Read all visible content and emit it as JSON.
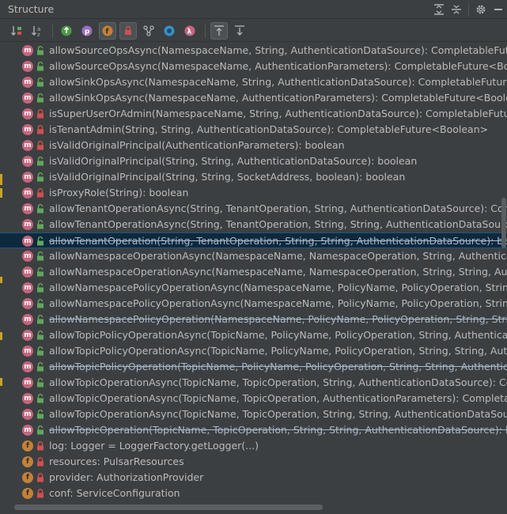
{
  "window": {
    "title": "Structure"
  },
  "toolbar": {
    "items": [
      {
        "name": "sort-by-visibility-icon"
      },
      {
        "name": "sort-alphabetically-icon"
      },
      {
        "name": "show-inherited-icon"
      },
      {
        "name": "show-properties-icon"
      },
      {
        "name": "show-fields-icon"
      },
      {
        "name": "show-non-public-icon"
      },
      {
        "name": "show-lambdas-icon"
      },
      {
        "name": "show-anonymous-icon"
      },
      {
        "name": "show-lambda-icon"
      },
      {
        "name": "autoscroll-to-source-icon"
      },
      {
        "name": "autoscroll-from-source-icon"
      }
    ]
  },
  "colors": {
    "method_badge": "#c5657e",
    "field_badge": "#c2813a",
    "public_lock": "#5fa85b",
    "private_lock": "#d05050",
    "selection": "#0d293e"
  },
  "members": [
    {
      "kind": "m",
      "access": "public",
      "text": "allowSourceOpsAsync(NamespaceName, String, AuthenticationDataSource): CompletableFuture<Boolean>",
      "strike": false
    },
    {
      "kind": "m",
      "access": "public",
      "text": "allowSourceOpsAsync(NamespaceName, AuthenticationParameters): CompletableFuture<Boolean>",
      "strike": false
    },
    {
      "kind": "m",
      "access": "public",
      "text": "allowSinkOpsAsync(NamespaceName, String, AuthenticationDataSource): CompletableFuture<Boolean>",
      "strike": false
    },
    {
      "kind": "m",
      "access": "public",
      "text": "allowSinkOpsAsync(NamespaceName, AuthenticationParameters): CompletableFuture<Boolean>",
      "strike": false
    },
    {
      "kind": "m",
      "access": "private",
      "text": "isSuperUserOrAdmin(NamespaceName, String, AuthenticationDataSource): CompletableFuture<Boolean>",
      "strike": false
    },
    {
      "kind": "m",
      "access": "private",
      "text": "isTenantAdmin(String, String, AuthenticationDataSource): CompletableFuture<Boolean>",
      "strike": false
    },
    {
      "kind": "m",
      "access": "private",
      "text": "isValidOriginalPrincipal(AuthenticationParameters): boolean",
      "strike": false
    },
    {
      "kind": "m",
      "access": "public",
      "text": "isValidOriginalPrincipal(String, String, AuthenticationDataSource): boolean",
      "strike": false
    },
    {
      "kind": "m",
      "access": "public",
      "text": "isValidOriginalPrincipal(String, String, SocketAddress, boolean): boolean",
      "strike": false
    },
    {
      "kind": "m",
      "access": "private",
      "text": "isProxyRole(String): boolean",
      "strike": false
    },
    {
      "kind": "m",
      "access": "public",
      "text": "allowTenantOperationAsync(String, TenantOperation, String, AuthenticationDataSource): CompletableFuture<Boolean>",
      "strike": false
    },
    {
      "kind": "m",
      "access": "public",
      "text": "allowTenantOperationAsync(String, TenantOperation, String, String, AuthenticationDataSource): CompletableFuture<Boolean>",
      "strike": false
    },
    {
      "kind": "m",
      "access": "public",
      "text": "allowTenantOperation(String, TenantOperation, String, String, AuthenticationDataSource): boolean",
      "strike": true,
      "selected": true
    },
    {
      "kind": "m",
      "access": "public",
      "text": "allowNamespaceOperationAsync(NamespaceName, NamespaceOperation, String, AuthenticationDataSource): CompletableFuture<Boolean>",
      "strike": false
    },
    {
      "kind": "m",
      "access": "public",
      "text": "allowNamespaceOperationAsync(NamespaceName, NamespaceOperation, String, String, AuthenticationDataSource): CompletableFuture<Boolean>",
      "strike": false
    },
    {
      "kind": "m",
      "access": "public",
      "text": "allowNamespacePolicyOperationAsync(NamespaceName, PolicyName, PolicyOperation, String, AuthenticationDataSource): CompletableFuture<Boolean>",
      "strike": false
    },
    {
      "kind": "m",
      "access": "public",
      "text": "allowNamespacePolicyOperationAsync(NamespaceName, PolicyName, PolicyOperation, String, String, AuthenticationDataSource): CompletableFuture<Boolean>",
      "strike": false
    },
    {
      "kind": "m",
      "access": "public",
      "text": "allowNamespacePolicyOperation(NamespaceName, PolicyName, PolicyOperation, String, String, AuthenticationDataSource): boolean",
      "strike": true
    },
    {
      "kind": "m",
      "access": "public",
      "text": "allowTopicPolicyOperationAsync(TopicName, PolicyName, PolicyOperation, String, AuthenticationDataSource): CompletableFuture<Boolean>",
      "strike": false
    },
    {
      "kind": "m",
      "access": "public",
      "text": "allowTopicPolicyOperationAsync(TopicName, PolicyName, PolicyOperation, String, String, AuthenticationDataSource): CompletableFuture<Boolean>",
      "strike": false
    },
    {
      "kind": "m",
      "access": "public",
      "text": "allowTopicPolicyOperation(TopicName, PolicyName, PolicyOperation, String, String, AuthenticationDataSource): boolean",
      "strike": true
    },
    {
      "kind": "m",
      "access": "public",
      "text": "allowTopicOperationAsync(TopicName, TopicOperation, String, AuthenticationDataSource): CompletableFuture<Boolean>",
      "strike": false
    },
    {
      "kind": "m",
      "access": "public",
      "text": "allowTopicOperationAsync(TopicName, TopicOperation, AuthenticationParameters): CompletableFuture<Boolean>",
      "strike": false
    },
    {
      "kind": "m",
      "access": "public",
      "text": "allowTopicOperationAsync(TopicName, TopicOperation, String, String, AuthenticationDataSource): CompletableFuture<Boolean>",
      "strike": false
    },
    {
      "kind": "m",
      "access": "public",
      "text": "allowTopicOperation(TopicName, TopicOperation, String, String, AuthenticationDataSource): boolean",
      "strike": true
    },
    {
      "kind": "f",
      "access": "private",
      "text": "log: Logger = LoggerFactory.getLogger(...)",
      "strike": false
    },
    {
      "kind": "f",
      "access": "private",
      "text": "resources: PulsarResources",
      "strike": false
    },
    {
      "kind": "f",
      "access": "private",
      "text": "provider: AuthorizationProvider",
      "strike": false
    },
    {
      "kind": "f",
      "access": "private",
      "text": "conf: ServiceConfiguration",
      "strike": false
    }
  ]
}
